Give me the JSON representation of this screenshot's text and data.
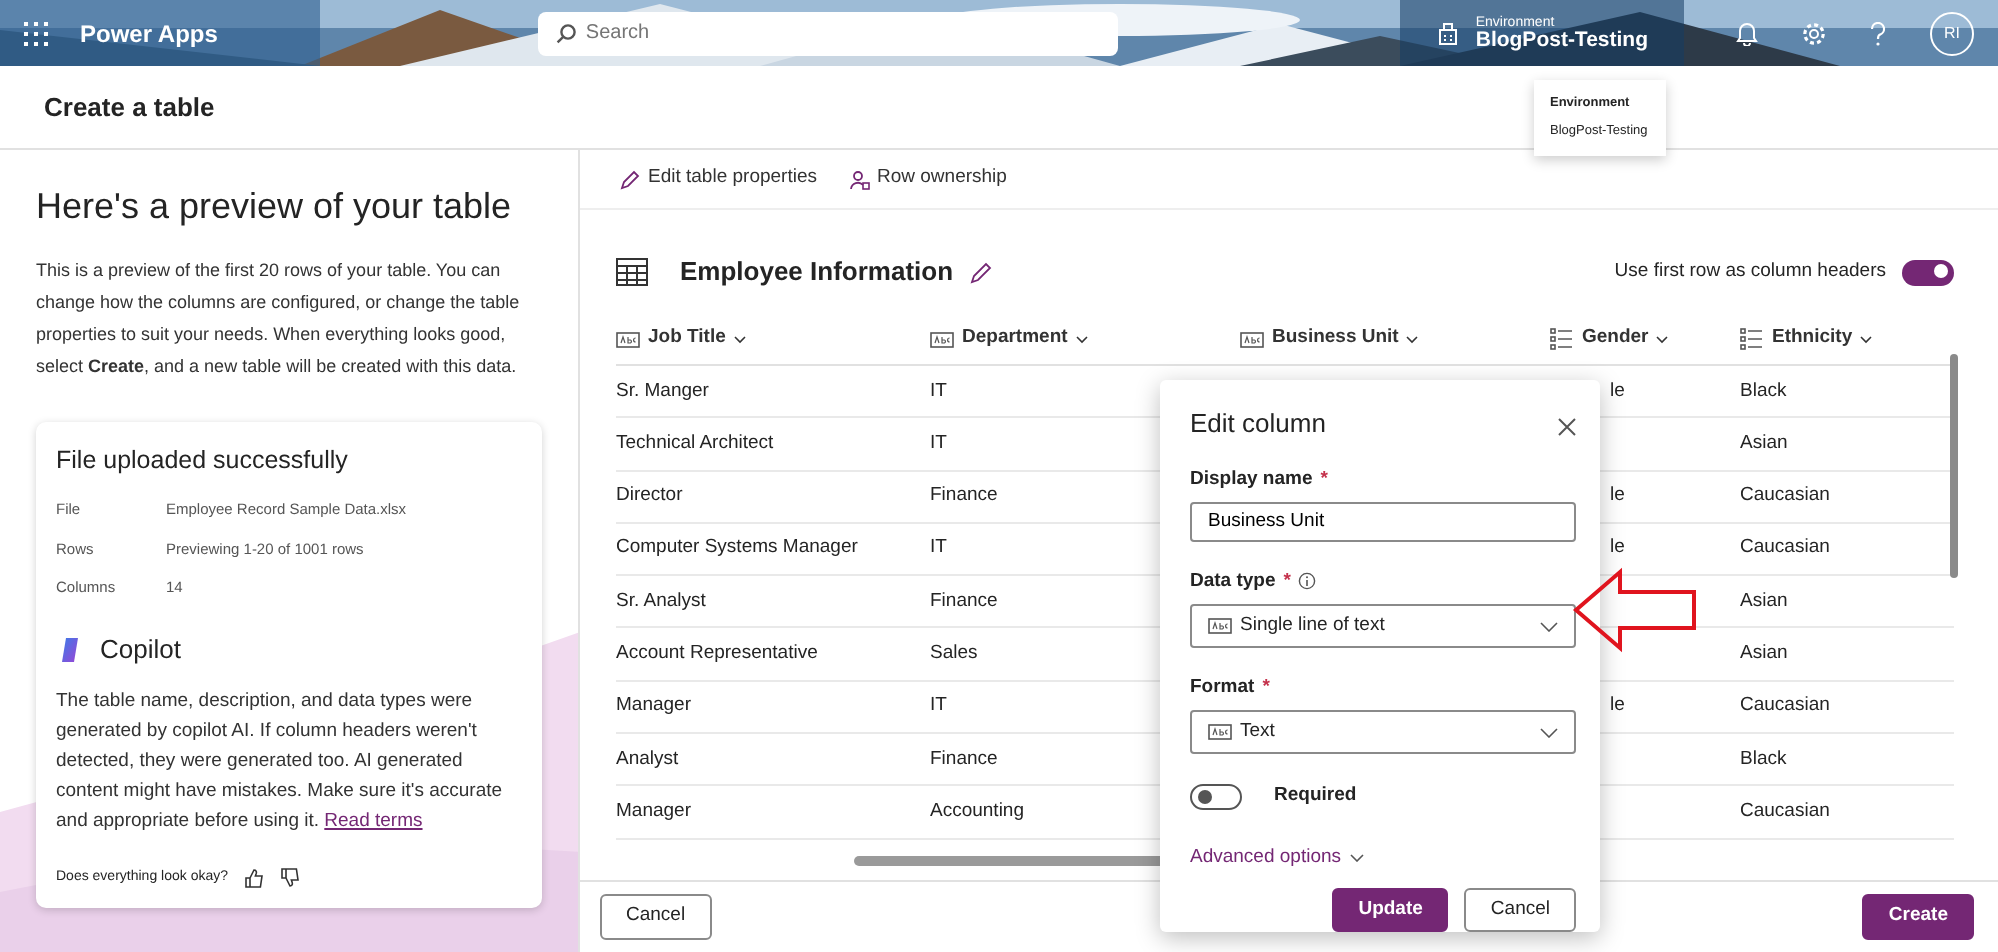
{
  "app_bar": {
    "app_name": "Power Apps",
    "search": {
      "placeholder": "Search"
    },
    "environment": {
      "label": "Environment",
      "name": "BlogPost-Testing"
    },
    "avatar": "RI"
  },
  "environment_tooltip": {
    "label": "Environment",
    "name": "BlogPost-Testing"
  },
  "page_title": "Create a table",
  "preview": {
    "heading": "Here's a preview of your table",
    "description": "This is a preview of the first 20 rows of your table. You can change how the columns are configured, or change the table properties to suit your needs. When everything looks good, select **Create**, and a new table will be created with this data.",
    "upload_card": {
      "title": "File uploaded successfully",
      "details": [
        {
          "label": "File",
          "value": "Employee Record Sample Data.xlsx"
        },
        {
          "label": "Rows",
          "value": "Previewing 1-20 of 1001 rows"
        },
        {
          "label": "Columns",
          "value": "14"
        }
      ],
      "copilot_title": "Copilot",
      "copilot_text": "The table name, description, and data types were generated by copilot AI. If column headers weren't detected, they were generated too. AI generated content might have mistakes. Make sure it's accurate and appropriate before using it.",
      "read_terms_link": "Read terms",
      "feedback_prompt": "Does everything look okay?"
    }
  },
  "toolbar": [
    "Edit table properties",
    "Row ownership"
  ],
  "table": {
    "name": "Employee Information",
    "first_row_headers": {
      "label": "Use first row as column headers",
      "on": true
    },
    "columns": [
      {
        "label": "Job Title",
        "kind": "text"
      },
      {
        "label": "Department",
        "kind": "text"
      },
      {
        "label": "Business Unit",
        "kind": "text"
      },
      {
        "label": "Gender",
        "kind": "choice"
      },
      {
        "label": "Ethnicity",
        "kind": "choice"
      }
    ],
    "rows": [
      {
        "job_title": "Sr. Manger",
        "department": "IT",
        "gender": "le",
        "ethnicity": "Black"
      },
      {
        "job_title": "Technical Architect",
        "department": "IT",
        "ethnicity": "Asian"
      },
      {
        "job_title": "Director",
        "department": "Finance",
        "gender": "le",
        "ethnicity": "Caucasian"
      },
      {
        "job_title": "Computer Systems Manager",
        "department": "IT",
        "gender": "le",
        "ethnicity": "Caucasian"
      },
      {
        "job_title": "Sr. Analyst",
        "department": "Finance",
        "ethnicity": "Asian"
      },
      {
        "job_title": "Account Representative",
        "department": "Sales",
        "ethnicity": "Asian"
      },
      {
        "job_title": "Manager",
        "department": "IT",
        "gender": "le",
        "ethnicity": "Caucasian"
      },
      {
        "job_title": "Analyst",
        "department": "Finance",
        "ethnicity": "Black"
      },
      {
        "job_title": "Manager",
        "department": "Accounting",
        "ethnicity": "Caucasian"
      }
    ]
  },
  "edit_column": {
    "title": "Edit column",
    "display_name": {
      "label": "Display name",
      "required_mark": "*",
      "value": "Business Unit"
    },
    "data_type": {
      "label": "Data type",
      "required_mark": "*",
      "value": "Single line of text"
    },
    "format": {
      "label": "Format",
      "required_mark": "*",
      "value": "Text"
    },
    "required_toggle": {
      "label": "Required",
      "on": false
    },
    "advanced_options": "Advanced options",
    "buttons": [
      "Update",
      "Cancel"
    ]
  },
  "footer": {
    "buttons": [
      "Cancel",
      "Create"
    ]
  }
}
